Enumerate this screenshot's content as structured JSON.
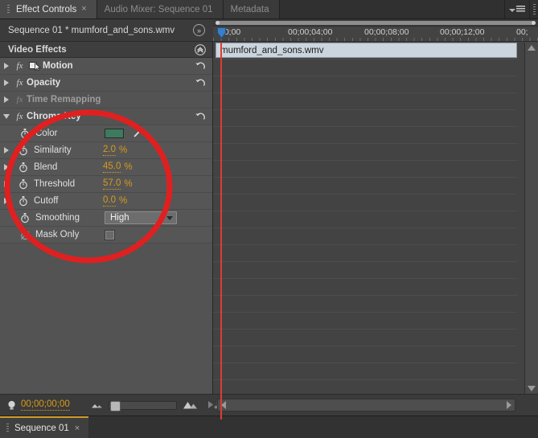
{
  "tabs": [
    {
      "label": "Effect Controls",
      "active": true,
      "closable": true
    },
    {
      "label": "Audio Mixer: Sequence 01",
      "active": false,
      "closable": false
    },
    {
      "label": "Metadata",
      "active": false,
      "closable": false
    }
  ],
  "sequence_header": {
    "title": "Sequence 01 * mumford_and_sons.wmv",
    "icon": "double-chevron-right-icon"
  },
  "effects_panel": {
    "header": "Video Effects",
    "collapse_icon": "double-chevron-up-icon",
    "effects": [
      {
        "name": "Motion",
        "expanded": false,
        "enabled": true,
        "has_reset": true,
        "icon": "transform-icon"
      },
      {
        "name": "Opacity",
        "expanded": false,
        "enabled": true,
        "has_reset": true
      },
      {
        "name": "Time Remapping",
        "expanded": false,
        "enabled": false,
        "has_reset": false
      },
      {
        "name": "Chroma Key",
        "expanded": true,
        "enabled": true,
        "has_reset": true
      }
    ],
    "chroma_key_params": [
      {
        "name": "Color",
        "type": "color",
        "value": "#3d7a5e",
        "expandable": false,
        "stopwatch": true,
        "eyedropper": true
      },
      {
        "name": "Similarity",
        "type": "percent",
        "value": "2.0",
        "unit": "%",
        "expandable": true,
        "stopwatch": true
      },
      {
        "name": "Blend",
        "type": "percent",
        "value": "45.0",
        "unit": "%",
        "expandable": true,
        "stopwatch": true
      },
      {
        "name": "Threshold",
        "type": "percent",
        "value": "57.0",
        "unit": "%",
        "expandable": true,
        "stopwatch": true
      },
      {
        "name": "Cutoff",
        "type": "percent",
        "value": "0.0",
        "unit": "%",
        "expandable": true,
        "stopwatch": true
      },
      {
        "name": "Smoothing",
        "type": "select",
        "value": "High",
        "expandable": false,
        "stopwatch": true
      },
      {
        "name": "Mask Only",
        "type": "checkbox",
        "value": false,
        "expandable": false,
        "stopwatch": true
      }
    ]
  },
  "timeline": {
    "ruler_ticks": [
      "00;00",
      "00;00;04;00",
      "00;00;08;00",
      "00;00;12;00",
      "00;"
    ],
    "clip_name": "mumford_and_sons.wmv",
    "playhead_icon": "playhead-marker-icon"
  },
  "status_bar": {
    "timecode": "00;00;00;00",
    "bulb_icon": "keyframe-bulb-icon",
    "zoom_out_icon": "small-mountain-icon",
    "zoom_in_icon": "large-mountain-icon",
    "play_keyframe_icon": "play-audio-icon",
    "export_icon": "export-frame-icon"
  },
  "sequence_tabs": [
    {
      "label": "Sequence 01",
      "active": true,
      "closable": true
    }
  ],
  "colors": {
    "accent_orange": "#d99b19",
    "annotation_red": "#e02020",
    "chroma_green": "#3d7a5e",
    "tab_active_underline": "#d29b2c"
  }
}
